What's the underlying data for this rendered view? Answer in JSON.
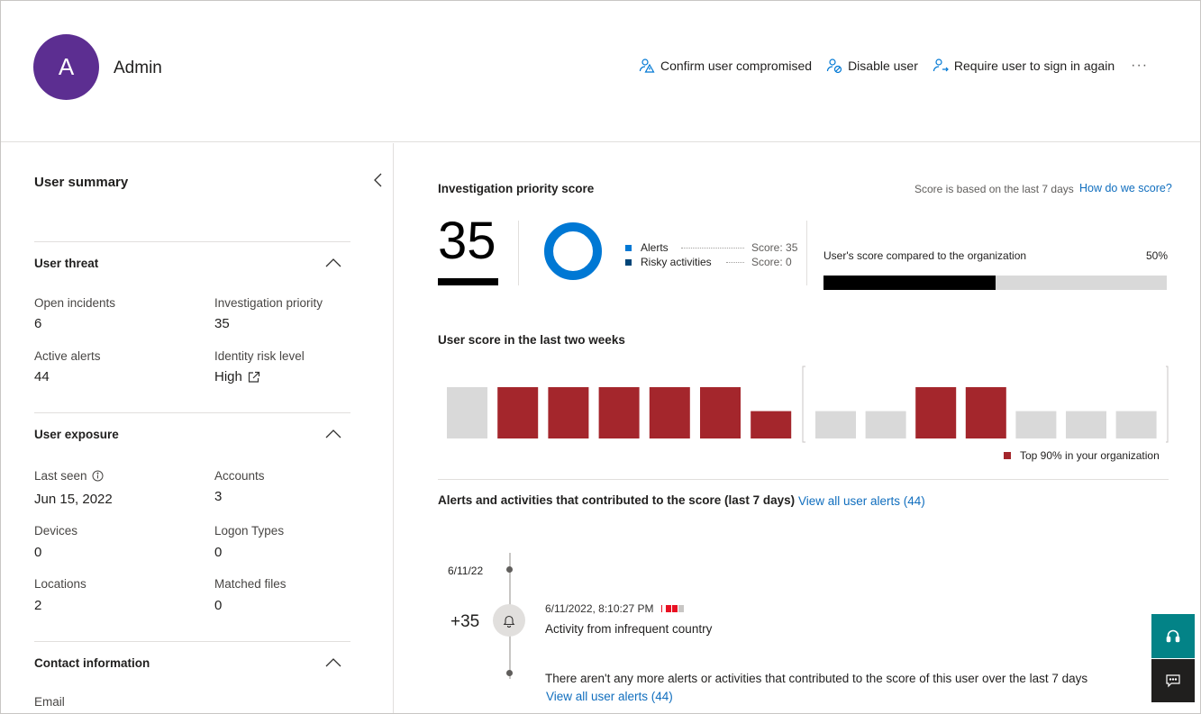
{
  "header": {
    "avatar_initial": "A",
    "user_name": "Admin",
    "actions": {
      "confirm": "Confirm user compromised",
      "disable": "Disable user",
      "require": "Require user to sign in again",
      "more": "···"
    }
  },
  "summary": {
    "title": "User summary",
    "threat": {
      "title": "User threat",
      "open_incidents_label": "Open incidents",
      "open_incidents": "6",
      "investigation_priority_label": "Investigation priority",
      "investigation_priority": "35",
      "active_alerts_label": "Active alerts",
      "active_alerts": "44",
      "identity_risk_label": "Identity risk level",
      "identity_risk": "High"
    },
    "exposure": {
      "title": "User exposure",
      "last_seen_label": "Last seen",
      "last_seen": "Jun 15, 2022",
      "accounts_label": "Accounts",
      "accounts": "3",
      "devices_label": "Devices",
      "devices": "0",
      "logon_types_label": "Logon Types",
      "logon_types": "0",
      "locations_label": "Locations",
      "locations": "2",
      "matched_files_label": "Matched files",
      "matched_files": "0"
    },
    "contact": {
      "title": "Contact information",
      "email_label": "Email"
    }
  },
  "priority": {
    "title": "Investigation priority score",
    "note": "Score is based on the last 7 days",
    "how_link": "How do we score?",
    "score": "35",
    "legend": [
      {
        "label": "Alerts",
        "score": "Score: 35",
        "color": "#0078d4"
      },
      {
        "label": "Risky activities",
        "score": "Score: 0",
        "color": "#004578"
      }
    ],
    "compare_title": "User's score compared to the organization",
    "compare_pct": "50%",
    "compare_value": 0.5
  },
  "two_weeks": {
    "title": "User score in the last two weeks",
    "legend": "Top 90% in your organization",
    "colors": {
      "top": "#a4262c",
      "normal": "#d9d9d9"
    }
  },
  "chart_data": {
    "type": "bar",
    "title": "User score in the last two weeks",
    "groups": [
      {
        "values": [
          0.75,
          0.75,
          0.75,
          0.75,
          0.75,
          0.75,
          0.4
        ],
        "top90": [
          false,
          true,
          true,
          true,
          true,
          true,
          true
        ]
      },
      {
        "values": [
          0.4,
          0.4,
          0.75,
          0.75,
          0.4,
          0.4,
          0.4
        ],
        "top90": [
          false,
          false,
          true,
          true,
          false,
          false,
          false
        ]
      }
    ],
    "legend": "Top 90% in your organization"
  },
  "alerts": {
    "title": "Alerts and activities that contributed to the score (last 7 days)",
    "view_all": "View all user alerts (44)",
    "date": "6/11/22",
    "delta": "+35",
    "event_time": "6/11/2022, 8:10:27 PM",
    "event_title": "Activity from infrequent country",
    "no_more": "There aren't any more alerts or activities that contributed to the score of this user over the last 7 days",
    "view_all_bottom": "View all user alerts (44)"
  }
}
